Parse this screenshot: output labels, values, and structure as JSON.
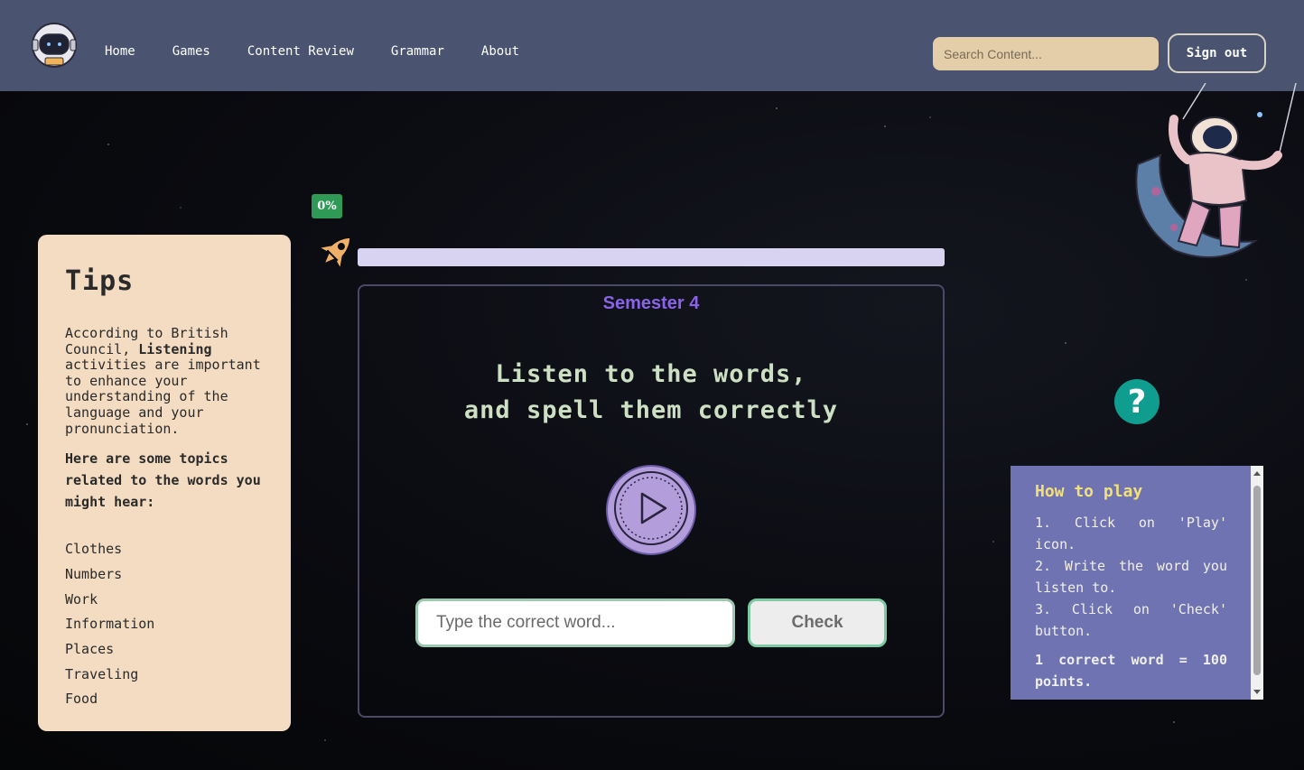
{
  "nav": {
    "links": [
      "Home",
      "Games",
      "Content Review",
      "Grammar",
      "About"
    ],
    "search_placeholder": "Search Content...",
    "signout_label": "Sign out"
  },
  "tips": {
    "title": "Tips",
    "intro_prefix": "According to British Council, ",
    "intro_bold": "Listening",
    "intro_suffix": " activities are important to enhance your understanding of the language and your pronunciation.",
    "subheading": "Here are some topics related to the words you might hear:",
    "topics": [
      "Clothes",
      "Numbers",
      "Work",
      "Information",
      "Places",
      "Traveling",
      "Food"
    ]
  },
  "progress": {
    "label": "0%",
    "value": 0
  },
  "game": {
    "semester": "Semester 4",
    "instruction_line1": "Listen to the words,",
    "instruction_line2": "and spell them correctly",
    "input_placeholder": "Type the correct word...",
    "check_label": "Check"
  },
  "help": {
    "icon_glyph": "?",
    "title": "How to play",
    "steps": [
      "1. Click on 'Play' icon.",
      "2. Write the word you listen to.",
      "3. Click on 'Check' button."
    ],
    "note": "1 correct word = 100 points."
  },
  "colors": {
    "navbar": "#4a5470",
    "tips_bg": "#f3dcc2",
    "semester": "#8a63e8",
    "help_button": "#0f9d90",
    "howto_bg": "#6f73b1",
    "progress_badge": "#2e9a55"
  },
  "icons": {
    "logo": "astronaut-helmet-icon",
    "rocket": "rocket-icon",
    "play": "play-icon",
    "help": "question-icon"
  }
}
